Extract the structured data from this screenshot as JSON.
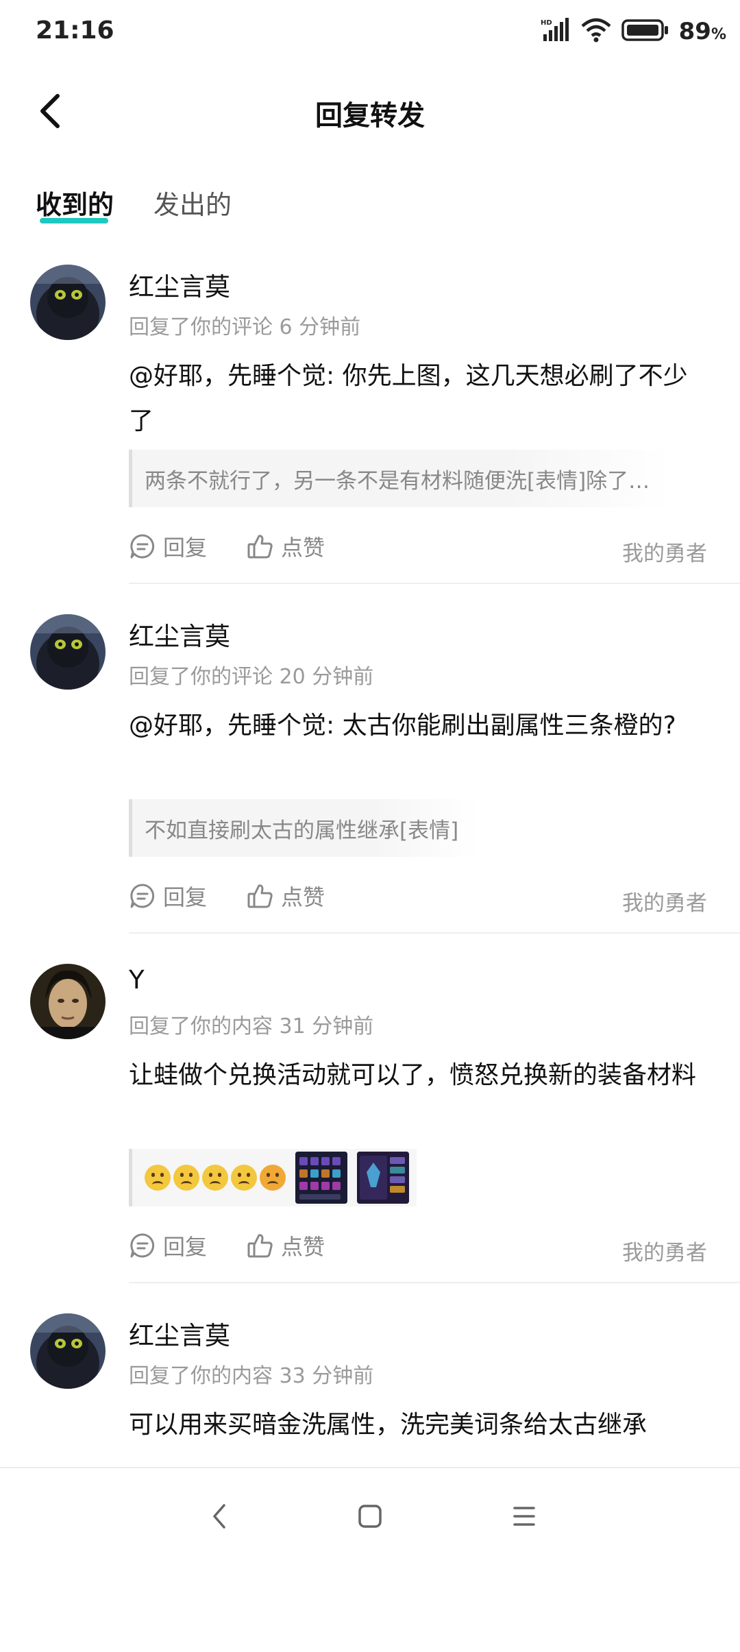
{
  "status": {
    "time": "21:16",
    "battery": "89",
    "battery_unit": "%",
    "network": "HD"
  },
  "header": {
    "title": "回复转发"
  },
  "tabs": [
    {
      "label": "收到的"
    },
    {
      "label": "发出的"
    }
  ],
  "items": [
    {
      "user": "红尘言莫",
      "meta": "回复了你的评论 6 分钟前",
      "content": "@好耶，先睡个觉: 你先上图，这几天想必刷了不少了",
      "quote": "两条不就行了，另一条不是有材料随便洗[表情]除了…",
      "reply": "回复",
      "like": "点赞",
      "tag": "我的勇者"
    },
    {
      "user": "红尘言莫",
      "meta": "回复了你的评论 20 分钟前",
      "content": "@好耶，先睡个觉: 太古你能刷出副属性三条橙的?",
      "quote": "不如直接刷太古的属性继承[表情]",
      "reply": "回复",
      "like": "点赞",
      "tag": "我的勇者"
    },
    {
      "user": "Y",
      "meta": "回复了你的内容 31 分钟前",
      "content": "让蛙做个兑换活动就可以了，愤怒兑换新的装备材料",
      "reply": "回复",
      "like": "点赞",
      "tag": "我的勇者"
    },
    {
      "user": "红尘言莫",
      "meta": "回复了你的内容 33 分钟前",
      "content": "可以用来买暗金洗属性，洗完美词条给太古继承"
    }
  ],
  "colors": {
    "accent": "#1ec8c0",
    "meta": "#9a9a9a"
  }
}
